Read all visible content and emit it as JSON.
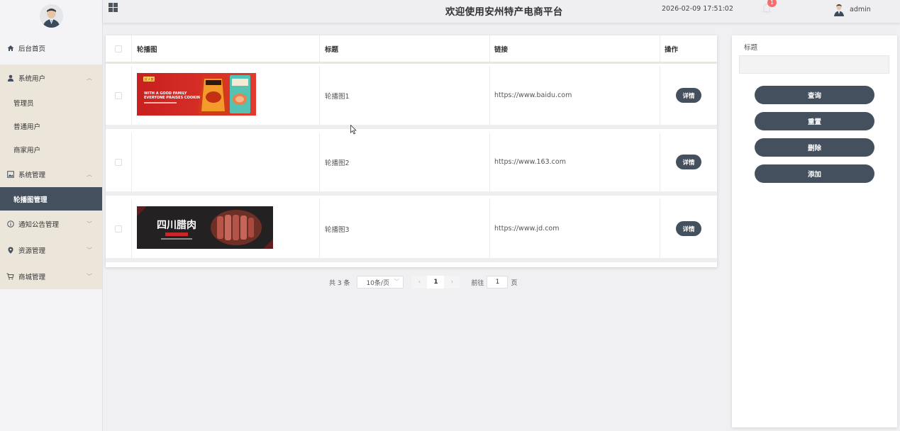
{
  "header": {
    "title": "欢迎使用安州特产电商平台",
    "datetime": "2026-02-09 17:51:02",
    "notification_count": "1",
    "username": "admin"
  },
  "sidebar": {
    "home": "后台首页",
    "groups": [
      {
        "label": "系统用户",
        "items": [
          "管理员",
          "普通用户",
          "商家用户"
        ]
      },
      {
        "label": "系统管理",
        "items": [
          "轮播图管理"
        ]
      },
      {
        "label": "通知公告管理"
      },
      {
        "label": "资源管理"
      },
      {
        "label": "商城管理"
      }
    ]
  },
  "table": {
    "columns": [
      "轮播图",
      "标题",
      "链接",
      "操作"
    ],
    "rows": [
      {
        "title": "轮播图1",
        "link": "https://www.baidu.com",
        "action": "详情",
        "banner_text": "WITH A GOOD FAMILY EVERYONE PRAISES COOKING"
      },
      {
        "title": "轮播图2",
        "link": "https://www.163.com",
        "action": "详情"
      },
      {
        "title": "轮播图3",
        "link": "https://www.jd.com",
        "action": "详情",
        "banner_text": "四川腊肉"
      }
    ]
  },
  "pagination": {
    "total": "共 3 条",
    "page_size": "10条/页",
    "current_page": "1",
    "goto_label": "前往",
    "goto_value": "1",
    "page_suffix": "页"
  },
  "search": {
    "title_label": "标题",
    "buttons": [
      "查询",
      "重置",
      "删除",
      "添加"
    ]
  },
  "colors": {
    "accent": "#44505e",
    "sidebar_group_bg": "#ece5da",
    "badge": "#f56c6c"
  }
}
